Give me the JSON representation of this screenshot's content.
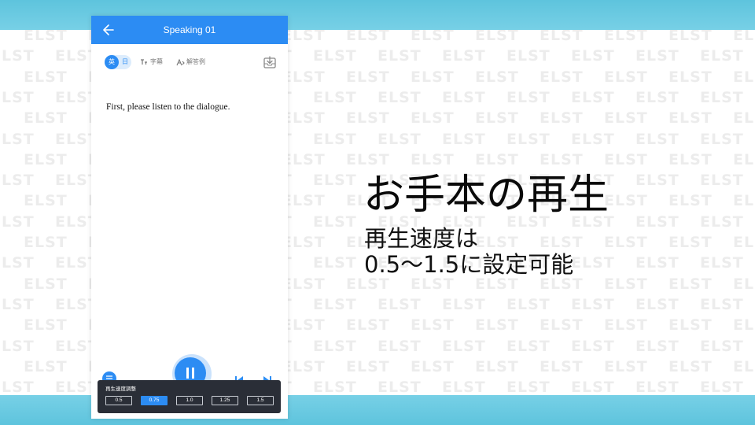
{
  "watermark_text": "ELST",
  "app": {
    "title": "Speaking 01",
    "lang_en": "英",
    "lang_ja": "日",
    "subtitle_label": "字幕",
    "answer_label": "解答例",
    "instruction": "First, please listen to the dialogue."
  },
  "speed_panel": {
    "title": "再生速度調整",
    "options": [
      "0.5",
      "0.75",
      "1.0",
      "1.25",
      "1.5"
    ],
    "selected": "0.75"
  },
  "caption": {
    "main": "お手本の再生",
    "sub_line1": "再生速度は",
    "sub_line2": "0.5〜1.5に設定可能"
  },
  "colors": {
    "accent": "#2c8cf3",
    "band": "#6ccbe2",
    "panel_dark": "#2a2e37"
  },
  "icons": {
    "back": "arrow-left-icon",
    "subtitle": "subtitle-icon",
    "answer": "answer-example-icon",
    "download": "download-box-icon",
    "list": "list-icon",
    "play": "pause-icon",
    "prev": "skip-previous-icon",
    "next": "skip-next-icon"
  }
}
